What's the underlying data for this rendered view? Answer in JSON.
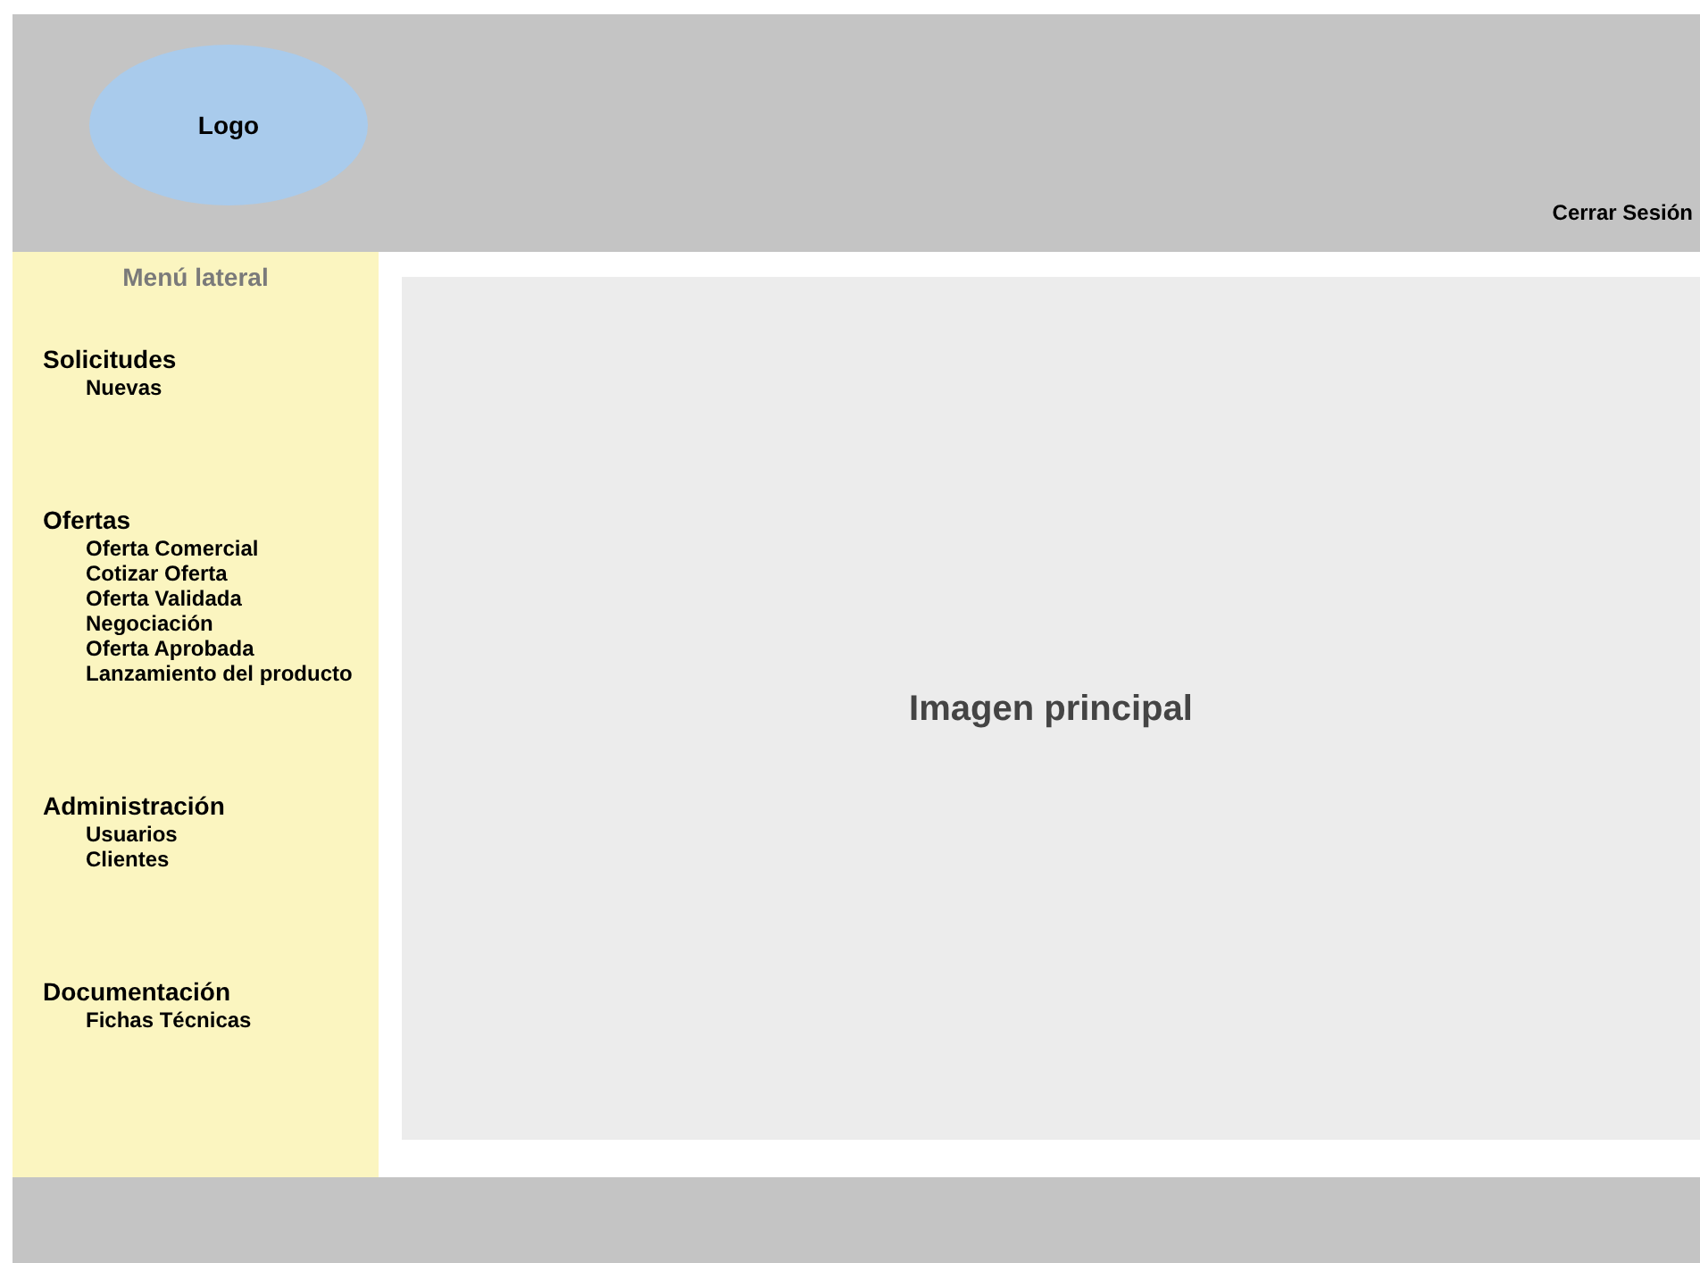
{
  "header": {
    "logo": "Logo",
    "logout": "Cerrar Sesión"
  },
  "sidebar": {
    "title": "Menú lateral",
    "sections": [
      {
        "title": "Solicitudes",
        "items": [
          "Nuevas"
        ]
      },
      {
        "title": "Ofertas",
        "items": [
          "Oferta Comercial",
          "Cotizar Oferta",
          "Oferta Validada",
          "Negociación",
          "Oferta Aprobada",
          "Lanzamiento del producto"
        ]
      },
      {
        "title": "Administración",
        "items": [
          "Usuarios",
          "Clientes"
        ]
      },
      {
        "title": "Documentación",
        "items": [
          "Fichas Técnicas"
        ]
      }
    ]
  },
  "main": {
    "label": "Imagen principal"
  }
}
